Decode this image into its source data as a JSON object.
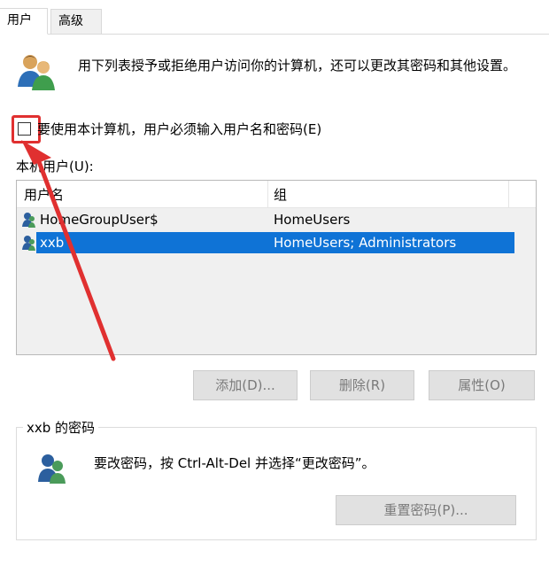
{
  "tabs": [
    {
      "label": "用户",
      "active": true
    },
    {
      "label": "高级",
      "active": false
    }
  ],
  "intro_text": "用下列表授予或拒绝用户访问你的计算机，还可以更改其密码和其他设置。",
  "require_password_checkbox": {
    "label": "要使用本计算机，用户必须输入用户名和密码(E)",
    "checked": false
  },
  "users_list": {
    "label": "本机用户(U):",
    "columns": [
      "用户名",
      "组"
    ],
    "rows": [
      {
        "name": "HomeGroupUser$",
        "group": "HomeUsers",
        "selected": false
      },
      {
        "name": "xxb",
        "group": "HomeUsers; Administrators",
        "selected": true
      }
    ]
  },
  "buttons": {
    "add": "添加(D)...",
    "remove": "删除(R)",
    "properties": "属性(O)",
    "reset_password": "重置密码(P)..."
  },
  "password_group": {
    "title": "xxb 的密码",
    "text": "要改密码，按 Ctrl-Alt-Del 并选择“更改密码”。"
  },
  "colors": {
    "selection": "#0f73d6",
    "annotation_red": "#e03030"
  }
}
